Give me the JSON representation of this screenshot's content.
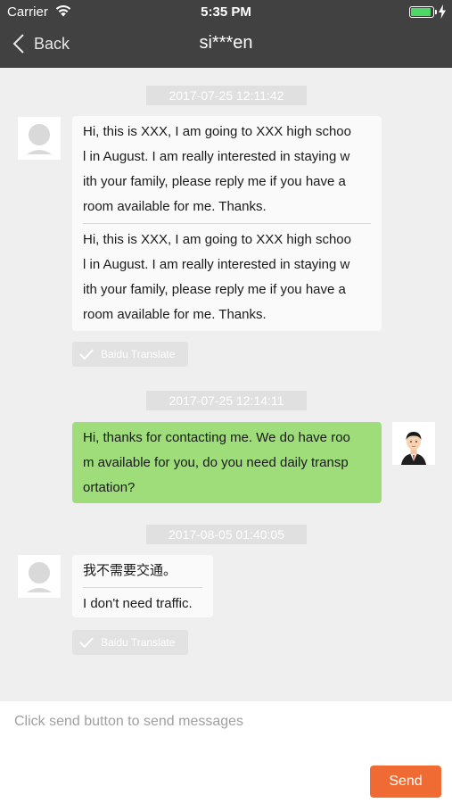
{
  "status_bar": {
    "carrier": "Carrier",
    "time": "5:35 PM",
    "icons": [
      "wifi-icon",
      "battery-icon",
      "charging-bolt-icon"
    ]
  },
  "nav": {
    "back_label": "Back",
    "title": "si***en"
  },
  "messages": [
    {
      "timestamp": "2017-07-25 12:11:42",
      "sender": "other",
      "original": [
        "Hi, this is XXX, I am going to XXX high schoo",
        "l in August. I am really interested in staying w",
        "ith your family, please reply me if you have a",
        "room available for me. Thanks."
      ],
      "translation": [
        "Hi, this is XXX, I am going to XXX high schoo",
        "l in August. I am really interested in staying w",
        "ith your family, please reply me if you have a",
        "room available for me. Thanks."
      ],
      "translate_label": "Baidu Translate"
    },
    {
      "timestamp": "2017-07-25 12:14:11",
      "sender": "me",
      "original": [
        "Hi, thanks for contacting me. We do have roo",
        "m available for you, do you need daily transp",
        "ortation?"
      ]
    },
    {
      "timestamp": "2017-08-05 01:40:05",
      "sender": "other",
      "original": [
        "我不需要交通。"
      ],
      "translation": [
        "I don't need traffic."
      ],
      "translate_label": "Baidu Translate"
    }
  ],
  "composer": {
    "placeholder": "Click send button to send messages",
    "value": "",
    "send_label": "Send"
  },
  "colors": {
    "nav_bg": "#414141",
    "chat_bg": "#efefef",
    "my_bubble": "#9fdc7a",
    "send_button": "#f06b33",
    "battery": "#4cd964"
  }
}
